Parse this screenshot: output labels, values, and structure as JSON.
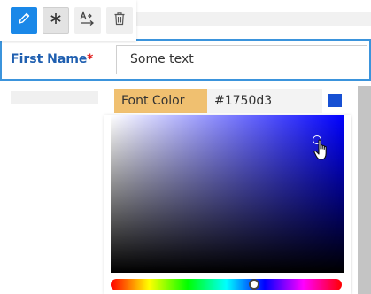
{
  "form": {
    "field_label": "First Name",
    "required_mark": "*",
    "input_value": "Some text"
  },
  "color_picker": {
    "label": "Font Color",
    "hex_value": "#1750d3",
    "swatch_color": "#1750d3"
  },
  "toolbar": {
    "icons": [
      "pencil-icon",
      "asterisk-icon",
      "text-direction-icon",
      "trash-icon"
    ]
  }
}
